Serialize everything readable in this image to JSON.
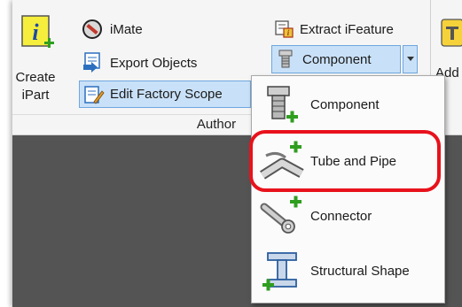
{
  "ribbon": {
    "create_ipart": {
      "line1": "Create",
      "line2": "iPart"
    },
    "imate": "iMate",
    "export_objects": "Export Objects",
    "edit_factory_scope": "Edit Factory Scope",
    "extract_ifeature": "Extract iFeature",
    "component": "Component",
    "cut_label": "Add",
    "group_label": "Author"
  },
  "menu": {
    "items": [
      {
        "label": "Component",
        "icon": "bolt-component-icon"
      },
      {
        "label": "Tube and Pipe",
        "icon": "tube-pipe-icon"
      },
      {
        "label": "Connector",
        "icon": "connector-icon"
      },
      {
        "label": "Structural Shape",
        "icon": "structural-shape-icon"
      }
    ]
  },
  "colors": {
    "highlight": "#e8121c",
    "pressed": "#c9e1f8",
    "add_plus": "#2f9e1f"
  }
}
